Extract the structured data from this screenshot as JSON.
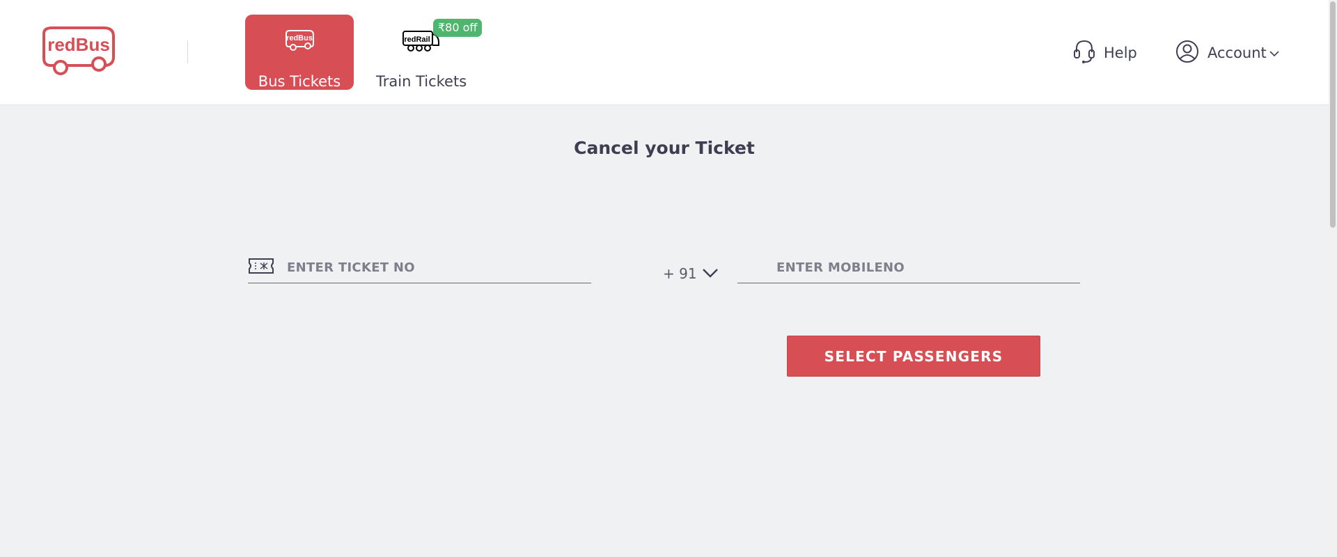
{
  "header": {
    "logo_text": "redBus",
    "tabs": [
      {
        "label": "Bus Tickets",
        "icon_text": "redBus",
        "icon": "bus-icon",
        "active": true
      },
      {
        "label": "Train Tickets",
        "icon_text": "redRail",
        "icon": "train-icon",
        "badge": "₹80 off",
        "active": false
      }
    ],
    "help_label": "Help",
    "account_label": "Account"
  },
  "main": {
    "title": "Cancel your Ticket",
    "ticket_placeholder": "ENTER TICKET NO",
    "country_code": "+ 91",
    "mobile_placeholder": "ENTER MOBILENO",
    "submit_label": "SELECT PASSENGERS"
  },
  "colors": {
    "brand": "#d84e55",
    "badge": "#32a956",
    "background": "#f0f1f2",
    "text": "#3e3e52"
  }
}
